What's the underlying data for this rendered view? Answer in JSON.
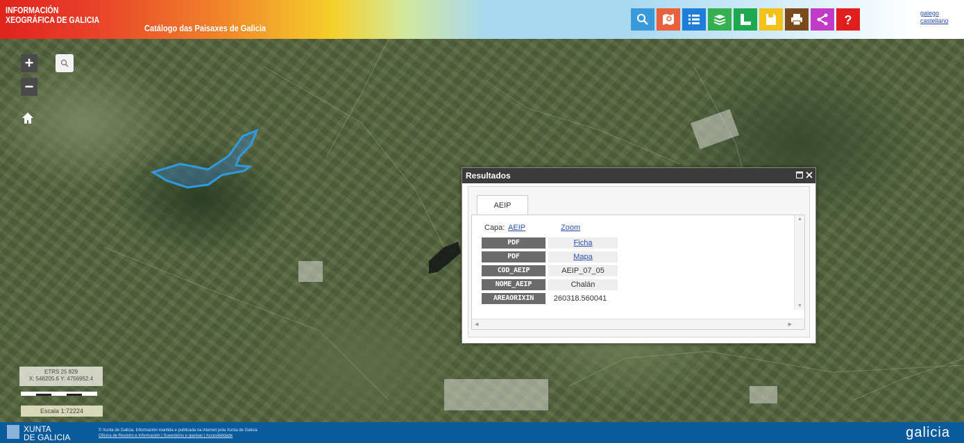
{
  "header": {
    "brand_line1": "INFORMACIÓN",
    "brand_line2": "XEOGRÁFICA DE GALICIA",
    "subtitle": "Catálogo das Paisaxes de Galicia",
    "tools": [
      {
        "name": "search",
        "color": "#3a9ad9"
      },
      {
        "name": "map-search",
        "color": "#e8603c"
      },
      {
        "name": "list",
        "color": "#1f7fd8"
      },
      {
        "name": "layers",
        "color": "#35b050"
      },
      {
        "name": "measure",
        "color": "#1ea850"
      },
      {
        "name": "save",
        "color": "#f2c21a"
      },
      {
        "name": "print",
        "color": "#7a4a1a"
      },
      {
        "name": "share",
        "color": "#c23bc8"
      },
      {
        "name": "help",
        "color": "#e01e1e"
      }
    ],
    "lang_line1": "galego",
    "lang_line2": "castellano"
  },
  "map": {
    "zoom_in": "+",
    "zoom_out": "−",
    "coord_line1": "ETRS 25 829",
    "coord_line2": "X: 546205.6 Y: 4756952.4",
    "scale_label": "Escala 1:72224"
  },
  "popup": {
    "title": "Resultados",
    "tab": "AEIP",
    "capa_label": "Capa:",
    "capa_link": "AEIP",
    "zoom_link": "Zoom",
    "rows": [
      {
        "label": "PDF",
        "value": "Ficha",
        "link": true
      },
      {
        "label": "PDF",
        "value": "Mapa",
        "link": true
      },
      {
        "label": "COD_AEIP",
        "value": "AEIP_07_05",
        "link": false
      },
      {
        "label": "NOME_AEIP",
        "value": "Chalán",
        "link": false
      },
      {
        "label": "AREAORIXIN",
        "value": "260318.560041",
        "link": false
      }
    ]
  },
  "footer": {
    "xunta_line1": "XUNTA",
    "xunta_line2": "DE GALICIA",
    "info_line1": "© Xunta de Galicia. Información mantida e publicada na internet pola Xunta de Galicia",
    "info_line2": "Oficina de Rexistro e Información | Suxestións e queixas | Accesibilidade",
    "brand": "galicia"
  }
}
